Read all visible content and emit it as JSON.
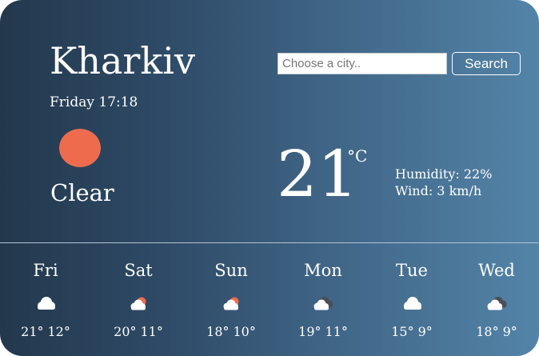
{
  "current": {
    "city": "Kharkiv",
    "datetime": "Friday 17:18",
    "icon": "sun-icon",
    "description": "Clear",
    "temperature": "21",
    "unit": "°C",
    "humidity": "Humidity: 22%",
    "wind": "Wind: 3 km/h"
  },
  "search": {
    "placeholder": "Choose a city..",
    "value": "",
    "button_label": "Search"
  },
  "forecast": [
    {
      "day": "Fri",
      "icon": "cloud-icon",
      "high": "21°",
      "low": "12°"
    },
    {
      "day": "Sat",
      "icon": "sun-behind-cloud-icon",
      "high": "20°",
      "low": "11°"
    },
    {
      "day": "Sun",
      "icon": "sun-behind-cloud-icon",
      "high": "18°",
      "low": "10°"
    },
    {
      "day": "Mon",
      "icon": "overcast-clouds-icon",
      "high": "19°",
      "low": "11°"
    },
    {
      "day": "Tue",
      "icon": "cloud-icon",
      "high": "15°",
      "low": "9°"
    },
    {
      "day": "Wed",
      "icon": "overcast-clouds-icon",
      "high": "18°",
      "low": "9°"
    }
  ],
  "colors": {
    "background_start": "#23384d",
    "background_end": "#5384a8",
    "sun": "#ee6c4d",
    "cloud": "#ffffff",
    "dark_cloud": "#4a4f57"
  }
}
